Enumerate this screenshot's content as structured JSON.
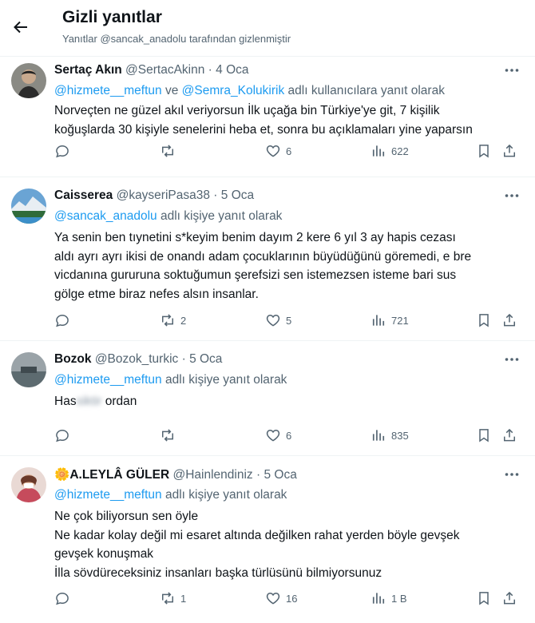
{
  "header": {
    "title": "Gizli yanıtlar",
    "subtitle": "Yanıtlar @sancak_anadolu tarafından gizlenmiştir"
  },
  "tweets": [
    {
      "name": "Sertaç Akın",
      "handle": "@SertacAkinn",
      "dot": "·",
      "date": "4 Oca",
      "mention1": "@hizmete__meftun",
      "connector": " ve ",
      "mention2": "@Semra_Kolukirik",
      "reply_suffix": " adlı kullanıcılara yanıt olarak",
      "body": [
        "Norveçten ne güzel akıl veriyorsun İlk uçağa bin Türkiye'ye git, 7 kişilik",
        "koğuşlarda 30 kişiyle senelerini heba et, sonra bu açıklamaları yine yaparsın"
      ],
      "replies": "",
      "retweets": "",
      "likes": "6",
      "views": "622"
    },
    {
      "name": "Caisserea",
      "handle": "@kayseriPasa38",
      "dot": "·",
      "date": "5 Oca",
      "mention1": "@sancak_anadolu",
      "reply_suffix": " adlı kişiye yanıt olarak",
      "body": [
        "Ya senin ben tıynetini s*keyim benim dayım 2 kere 6 yıl 3 ay hapis cezası",
        "aldı ayrı ayrı ikisi de onandı adam çocuklarının büyüdüğünü göremedi, e bre",
        "vicdanına gururuna soktuğumun şerefsizi sen istemezsen isteme bari sus",
        "gölge etme biraz nefes alsın insanlar."
      ],
      "replies": "",
      "retweets": "2",
      "likes": "5",
      "views": "721"
    },
    {
      "name": "Bozok",
      "handle": "@Bozok_turkic",
      "dot": "·",
      "date": "5 Oca",
      "mention1": "@hizmete__meftun",
      "reply_suffix": " adlı kişiye yanıt olarak",
      "body_parts": [
        "Has",
        "siktir",
        " ordan"
      ],
      "replies": "",
      "retweets": "",
      "likes": "6",
      "views": "835"
    },
    {
      "name": "A.LEYLÂ GÜLER",
      "name_emoji": "🌼",
      "handle": "@Hainlendiniz",
      "dot": "·",
      "date": "5 Oca",
      "mention1": "@hizmete__meftun",
      "reply_suffix": " adlı kişiye yanıt olarak",
      "body": [
        "Ne çok biliyorsun sen öyle",
        "Ne kadar kolay değil mi esaret altında değilken rahat yerden böyle gevşek",
        "gevşek konuşmak",
        "İlla sövdüreceksiniz insanları başka türlüsünü bilmiyorsunuz"
      ],
      "replies": "",
      "retweets": "1",
      "likes": "16",
      "views": "1 B"
    }
  ],
  "icons": {
    "back": "arrow-left-icon",
    "more": "more-dots-icon",
    "reply": "reply-bubble-icon",
    "retweet": "retweet-icon",
    "like": "heart-icon",
    "views": "views-bars-icon",
    "bookmark": "bookmark-icon",
    "share": "share-icon"
  },
  "colors": {
    "accent": "#1d9bf0",
    "muted": "#536471",
    "text": "#0f1419",
    "divider": "#eff3f4"
  }
}
